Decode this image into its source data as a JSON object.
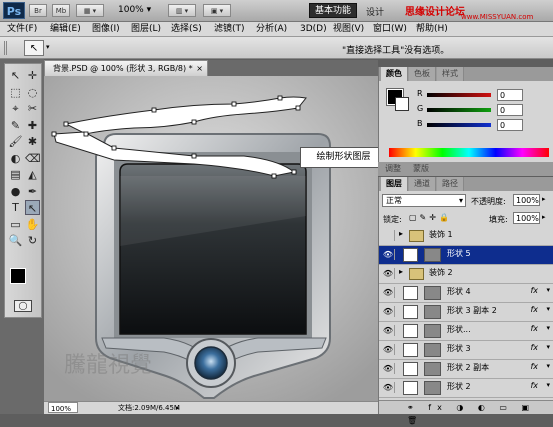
{
  "app": {
    "logo": "Ps",
    "bar_buttons": [
      "Br",
      "Mb"
    ],
    "zoom": "100%",
    "workspace_button": "基本功能",
    "workspace_next": "设计",
    "watermark_line1": "思缘设计论坛",
    "watermark_line2": "www.MISSYUAN.com"
  },
  "menu": [
    "文件(F)",
    "编辑(E)",
    "图像(I)",
    "图层(L)",
    "选择(S)",
    "滤镜(T)",
    "分析(A)",
    "3D(D)",
    "视图(V)",
    "窗口(W)",
    "帮助(H)"
  ],
  "options": {
    "tool_glyph": "↖",
    "message": "\"直接选择工具\"没有选项。"
  },
  "tools": [
    "↖",
    "✛",
    "⬚",
    "◌",
    "⌖",
    "✂",
    "✎",
    "✚",
    "🖌",
    "✱",
    "◐",
    "⌫",
    "▤",
    "◭",
    "●",
    "✒",
    "T",
    "↖",
    "▭",
    "✋",
    "🔍",
    "↻"
  ],
  "document": {
    "tab_title": "背景.PSD @ 100% (形状 3, RGB/8) *",
    "close": "×",
    "callout": "绘制形状图层",
    "zoom": "100%",
    "doc_info": "文档:2.09M/6.45M",
    "bottom_watermark": "騰龍視覺"
  },
  "color_panel": {
    "tabs": [
      "颜色",
      "色板",
      "样式"
    ],
    "channels": [
      {
        "label": "R",
        "value": "0",
        "color": "#d01010"
      },
      {
        "label": "G",
        "value": "0",
        "color": "#10a010"
      },
      {
        "label": "B",
        "value": "0",
        "color": "#1030d0"
      }
    ]
  },
  "layers_panel": {
    "tabs": [
      "图层",
      "通道",
      "路径"
    ],
    "blend_mode": "正常",
    "opacity_label": "不透明度:",
    "opacity_value": "100%",
    "lock_label": "锁定:",
    "fill_label": "填充:",
    "fill_value": "100%",
    "layers": [
      {
        "name": "装饰 1",
        "type": "group",
        "visible": false,
        "selected": false
      },
      {
        "name": "形状 5",
        "type": "shape",
        "visible": true,
        "selected": true
      },
      {
        "name": "装饰 2",
        "type": "group",
        "visible": true,
        "selected": false
      },
      {
        "name": "形状 4",
        "type": "shape",
        "visible": true,
        "selected": false,
        "fx": "fx"
      },
      {
        "name": "形状 3 副本 2",
        "type": "shape",
        "visible": true,
        "selected": false,
        "fx": "fx"
      },
      {
        "name": "形状...",
        "type": "shape",
        "visible": true,
        "selected": false,
        "fx": "fx"
      },
      {
        "name": "形状 3",
        "type": "shape",
        "visible": true,
        "selected": false,
        "fx": "fx"
      },
      {
        "name": "形状 2 副本",
        "type": "shape",
        "visible": true,
        "selected": false,
        "fx": "fx"
      },
      {
        "name": "形状 2",
        "type": "shape",
        "visible": true,
        "selected": false,
        "fx": "fx"
      }
    ]
  }
}
